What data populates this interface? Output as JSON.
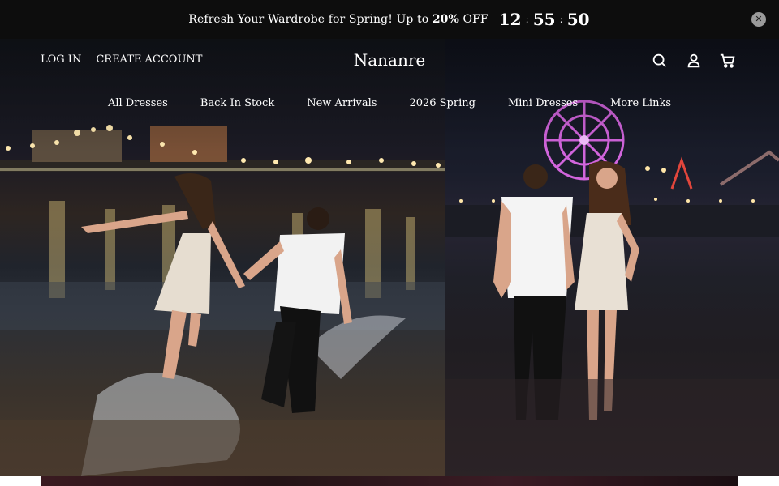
{
  "announcement": {
    "text": "Refresh Your Wardrobe for Spring! Up to",
    "percent": "20%",
    "suffix": "OFF",
    "countdown": {
      "hours": "12",
      "minutes": "55",
      "seconds": "50",
      "separator": ":"
    },
    "close_icon": "close-icon",
    "close_glyph": "✕"
  },
  "header": {
    "login_label": "LOG IN",
    "create_account_label": "CREATE ACCOUNT",
    "logo": "Nananre",
    "icons": [
      "search-icon",
      "account-icon",
      "cart-icon"
    ]
  },
  "nav": {
    "items": [
      "All Dresses",
      "Back In Stock",
      "New Arrivals",
      "2026 Spring",
      "Mini Dresses",
      "More Links"
    ]
  },
  "hero": {
    "slides_count": 2,
    "active_slide": 1
  },
  "colors": {
    "announcement_bg": "#0d0d0d",
    "text": "#ffffff"
  }
}
